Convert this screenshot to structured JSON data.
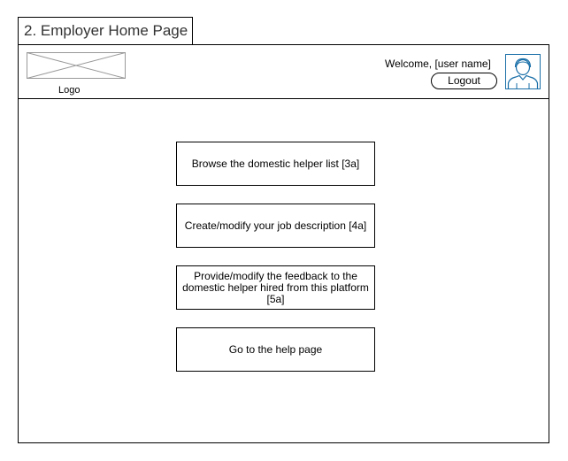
{
  "page": {
    "tab_title": "2. Employer Home Page"
  },
  "header": {
    "logo_label": "Logo",
    "welcome_text": "Welcome, [user name]",
    "logout_label": "Logout",
    "logo_icon": "image-placeholder-icon",
    "avatar_icon": "user-avatar-icon",
    "accent_color": "#1a6fa8"
  },
  "main": {
    "actions": [
      {
        "label": "Browse the domestic helper list [3a]"
      },
      {
        "label": "Create/modify your job description [4a]"
      },
      {
        "label": "Provide/modify the feedback to the domestic helper hired from this platform [5a]"
      },
      {
        "label": "Go to the help page"
      }
    ]
  }
}
